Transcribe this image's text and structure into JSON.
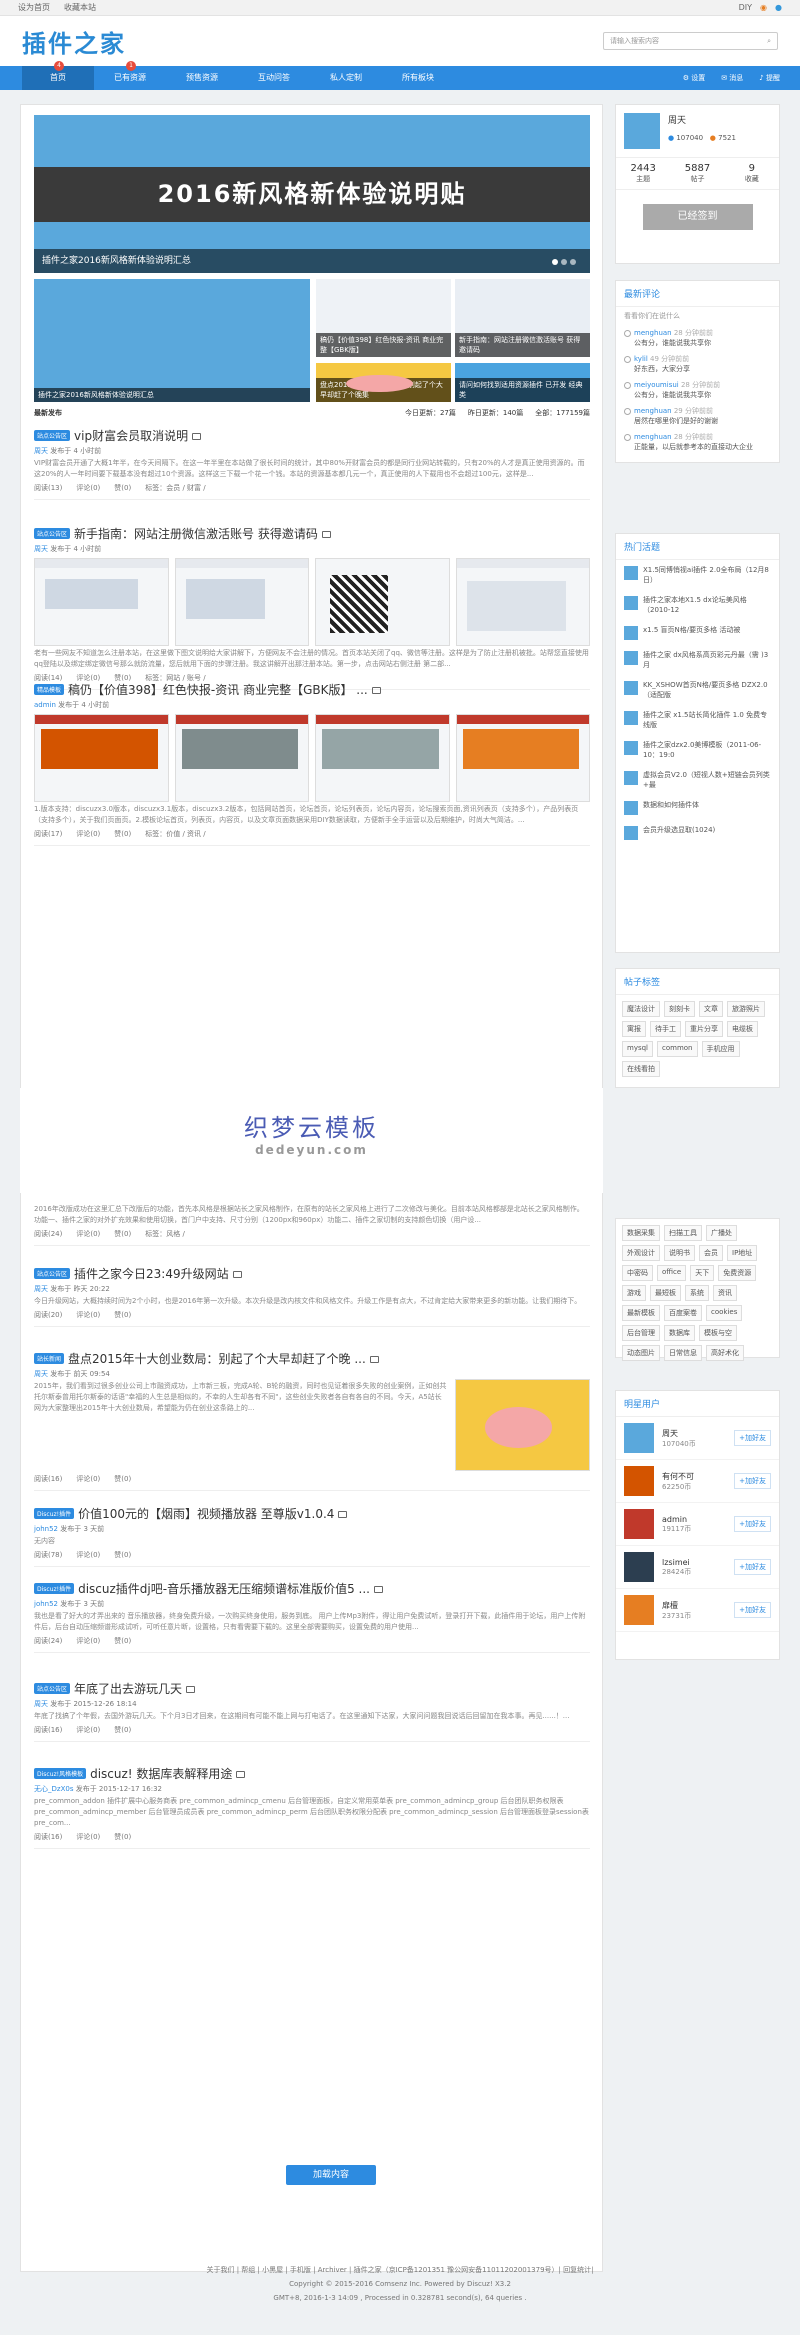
{
  "topbar": {
    "left": [
      "设为首页",
      "收藏本站"
    ],
    "right": [
      "DIY"
    ]
  },
  "header": {
    "logo": "插件之家",
    "search_placeholder": "请输入搜索内容"
  },
  "nav": {
    "items": [
      "首页",
      "已有资源",
      "预售资源",
      "互动问答",
      "私人定制",
      "所有板块"
    ],
    "badges": [
      "4",
      "1"
    ],
    "tools": [
      "设置",
      "消息",
      "提醒"
    ]
  },
  "banner": {
    "headline": "2016新风格新体验说明贴",
    "caption": "插件之家2016新风格新体验说明汇总"
  },
  "tiles": [
    {
      "caption": "插件之家2016新风格新体验说明汇总"
    },
    {
      "caption": "稿仍【价值398】红色快报-资讯 商业完整【GBK版】"
    },
    {
      "caption": "新手指南：网站注册微信激活账号 获得邀请码"
    },
    {
      "caption": "盘点2015年十大创业数局：别起了个大早却赶了个晚集"
    },
    {
      "caption": "请问如何找到适用资源插件 已开发 经典类"
    }
  ],
  "stats": {
    "label": "最新发布",
    "today": "今日更新：27篇",
    "yesterday": "昨日更新：140篇",
    "total": "全部：177159篇"
  },
  "threads": [
    {
      "tag": "站点公告区",
      "title": "vip财富会员取消说明",
      "meta_user": "周天",
      "meta_time": "发布于 4 小时前",
      "summary": "VIP财富会员开通了大概1年半，在今天间隔下。在这一年半里在本站做了很长时间的统计，其中80%开财富会员的都是同行业网站转载的，只有20%的人才是真正使用资源的。而这20%的人一年时间要下载基本没有超过10个资源。这样这三下载一个花一个钱。本站的资源基本都几元一个，真正使用的人下载用也不会超过100元，这样是...",
      "foot": [
        "阅读(13)",
        "评论(0)",
        "赞(0)",
        "标签：会员 / 财富 /"
      ]
    },
    {
      "tag": "站点公告区",
      "title": "新手指南：网站注册微信激活账号 获得邀请码",
      "meta_user": "周天",
      "meta_time": "发布于 4 小时前",
      "summary": "老有一些网友不知道怎么注册本站，在这里做下图文说明给大家讲解下，方便网友不会注册的情况。首页本站关闭了qq、微信等注册。这样是为了防止注册机被批。站帮您直接使用qq登陆以及绑定绑定微信号那么就防流量，您后就用下面的步骤注册。我这讲解开出那注册本站。第一步，点击网站右侧注册 第二部...",
      "foot": [
        "阅读(14)",
        "评论(0)",
        "赞(0)",
        "标签：网站 / 账号 /"
      ]
    },
    {
      "tag": "精品模板",
      "title": "稿仍【价值398】红色快报-资讯 商业完整【GBK版】 ...",
      "meta_user": "admin",
      "meta_time": "发布于 4 小时前",
      "summary": "1.版本支持：discuzx3.0版本，discuzx3.1版本，discuzx3.2版本，包括网站首页，论坛首页，论坛列表页，论坛内容页，论坛搜索页面,资讯列表页（支持多个），产品列表页（支持多个），关于我们页面页。2.模板论坛首页，列表页，内容页，以及文章页面数据采用DIY数据读取，方便新手全手运营以及后期维护，时尚大气简洁。...",
      "foot": [
        "阅读(17)",
        "评论(0)",
        "赞(0)",
        "标签：价值 / 资讯 /"
      ]
    },
    {
      "tag": "",
      "title": "",
      "meta_user": "",
      "meta_time": "",
      "summary": "2016年改版成功在这里汇总下改版后的功能，首先本风格是根据站长之家风格制作，在原有的站长之家风格上进行了二次修改与美化。目前本站风格都部是北站长之家风格制作。功能一、插件之家的对外扩充效果和使用切换，首门户中支持、尺寸分别（1200px和960px）功能二、插件之家切制的支持颜色切换（用户设...",
      "foot": [
        "阅读(24)",
        "评论(0)",
        "赞(0)",
        "标签：风格 /"
      ]
    },
    {
      "tag": "站点公告区",
      "title": "插件之家今日23:49升级网站",
      "meta_user": "周天",
      "meta_time": "发布于 昨天 20:22",
      "summary": "今日升级网站，大概持续时间为2个小时，也是2016年第一次升级。本次升级是改内核文件和风格文件。升级工作是有点大，不过肯定给大家带来更多的新功能。让我们期待下。",
      "foot": [
        "阅读(20)",
        "评论(0)",
        "赞(0)"
      ]
    },
    {
      "tag": "站长新闻",
      "title": "盘点2015年十大创业数局：别起了个大早却赶了个晚 ...",
      "meta_user": "周天",
      "meta_time": "发布于 前天 09:54",
      "summary": "2015年，我们看到过很多创业公司上市融资成功，上市新三板，完成A轮、B轮的融资，同时也见证着很多失败的创业案例，正如创共托尔斯泰曾用托尔斯泰的话语\"幸福的人生总是相似的，不幸的人生却各有不同\"，这些创业失败者各自有各自的不同。今天，A5站长网为大家整理出2015年十大创业数局，希望能为仍在创业这条路上的...",
      "foot": [
        "阅读(16)",
        "评论(0)",
        "赞(0)"
      ]
    },
    {
      "tag": "Discuz!插件",
      "title": "价值100元的【烟雨】视频播放器 至尊版v1.0.4",
      "meta_user": "john52",
      "meta_time": "发布于 3 天前",
      "summary": "无内容",
      "foot": [
        "阅读(78)",
        "评论(0)",
        "赞(0)"
      ]
    },
    {
      "tag": "Discuz!插件",
      "title": "discuz插件dj吧-音乐播放器无压缩频谱标准版价值5 ...",
      "meta_user": "john52",
      "meta_time": "发布于 3 天前",
      "summary": "我也是看了好大的才弄出来的 音乐播放器，终身免费升级，一次购买终身使用，服务到底。 用户上传Mp3附件，得让用户免费试听，登录打开下载，此插件用于论坛，用户上传附件后，后台自动压缩频谱形成试听，可听任意片断，设置格，只有看需要下载的。这里全部需要购买，设置免费的用户使用...",
      "foot": [
        "阅读(24)",
        "评论(0)",
        "赞(0)"
      ]
    },
    {
      "tag": "站点公告区",
      "title": "年底了出去游玩几天",
      "meta_user": "周天",
      "meta_time": "发布于 2015-12-26 18:14",
      "summary": "年底了找搞了个年假，去国外游玩几天。下个月3日才回来，在这期间有可能不能上网与打电话了。在这里通知下达家，大家问问题我回说话后回留加在我本事。再见......！...",
      "foot": [
        "阅读(16)",
        "评论(0)",
        "赞(0)"
      ]
    },
    {
      "tag": "Discuz!风格模板",
      "title": "discuz! 数据库表解释用途",
      "meta_user": "无心_DzX0s",
      "meta_time": "发布于 2015-12-17 16:32",
      "summary": "pre_common_addon 插件扩展中心服务商表 pre_common_admincp_cmenu 后台管理面板，自定义常用菜单表 pre_common_admincp_group 后台团队职务权限表 pre_common_admincp_member 后台管理员成员表 pre_common_admincp_perm 后台团队职务权限分配表 pre_common_admincp_session 后台管理面板登录session表 pre_com...",
      "foot": [
        "阅读(16)",
        "评论(0)",
        "赞(0)"
      ]
    }
  ],
  "watermark": {
    "line1": "织梦云模板",
    "line2": "dedeyun.com"
  },
  "load_more": "加载内容",
  "profile": {
    "name": "周天",
    "coins": "107040",
    "credits": "7521",
    "stats": [
      {
        "n": "2443",
        "l": "主题"
      },
      {
        "n": "5887",
        "l": "帖子"
      },
      {
        "n": "9",
        "l": "收藏"
      }
    ],
    "signed": "已经签到"
  },
  "reviews": {
    "title": "最新评论",
    "placeholder": "看看你们在说什么",
    "items": [
      {
        "u": "menghuan",
        "t": "28 分钟前前",
        "c": "公有分，谁能说我共享你"
      },
      {
        "u": "kylil",
        "t": "49 分钟前前",
        "c": "好东西，大家分享"
      },
      {
        "u": "meiyoumisui",
        "t": "28 分钟前前",
        "c": "公有分，谁能说我共享你"
      },
      {
        "u": "menghuan",
        "t": "29 分钟前前",
        "c": "居然在哪里你们是好的谢谢"
      },
      {
        "u": "menghuan",
        "t": "28 分钟前前",
        "c": "正能量，以后就参考本的直接动大企业"
      }
    ]
  },
  "hot": {
    "title": "热门活题",
    "items": [
      "X1.5同博悄视ai插件 2.0全布局（12月8日）",
      "插件之家本地X1.5 dx论坛美风格（2010-12",
      "x1.5 盲页N格/要页多格 活动被",
      "插件之家 dx风格系高页彩元丹最（需 )3月",
      "KK_XSHOW首页N格/要页多格 DZX2.0（适配版",
      "插件之家 x1.5站长简化插件 1.0 免费专线版",
      "插件之家dzx2.0美博模板（2011-06-10：19:0",
      "虚拟会员V2.0（短视人数+短链会员列类+最",
      "数据和如何插件体",
      "会员升级选显取(1024)"
    ]
  },
  "tags": {
    "title": "帖子标签",
    "items": [
      "魔法设计",
      "刻刻卡",
      "文章",
      "旅游照片",
      "寓报",
      "待手工",
      "重片分享",
      "电缆板",
      "mysql",
      "common",
      "手机应用",
      "在线看拍"
    ]
  },
  "tags2": {
    "items": [
      "数据采集",
      "扫描工具",
      "广播处",
      "外观设计",
      "说明书",
      "会员",
      "IP地址",
      "中密码",
      "office",
      "天下",
      "免费资源",
      "游戏",
      "最短板",
      "系统",
      "资讯",
      "最新模板",
      "百度案卷",
      "cookies",
      "后台管理",
      "数据库",
      "模板与空",
      "动态图片",
      "日常信息",
      "高好术化"
    ]
  },
  "stars": {
    "title": "明星用户",
    "follow": "+加好友",
    "items": [
      {
        "n": "周天",
        "c": "107040币"
      },
      {
        "n": "有何不可",
        "c": "62250币"
      },
      {
        "n": "admin",
        "c": "19117币"
      },
      {
        "n": "lzsimei",
        "c": "28424币"
      },
      {
        "n": "扉檀",
        "c": "23731币"
      }
    ]
  },
  "footer": {
    "line1": "关于我们 | 帮组 | 小黑屋 | 手机版 | Archiver | 插件之家（京ICP备1201351 豫公网安备11011202001379号）| 回复统计|",
    "line2": "Copyright © 2015-2016 Comsenz Inc. Powered by Discuz! X3.2",
    "line3": "GMT+8, 2016-1-3 14:09 , Processed in 0.328781 second(s), 64 queries ."
  }
}
